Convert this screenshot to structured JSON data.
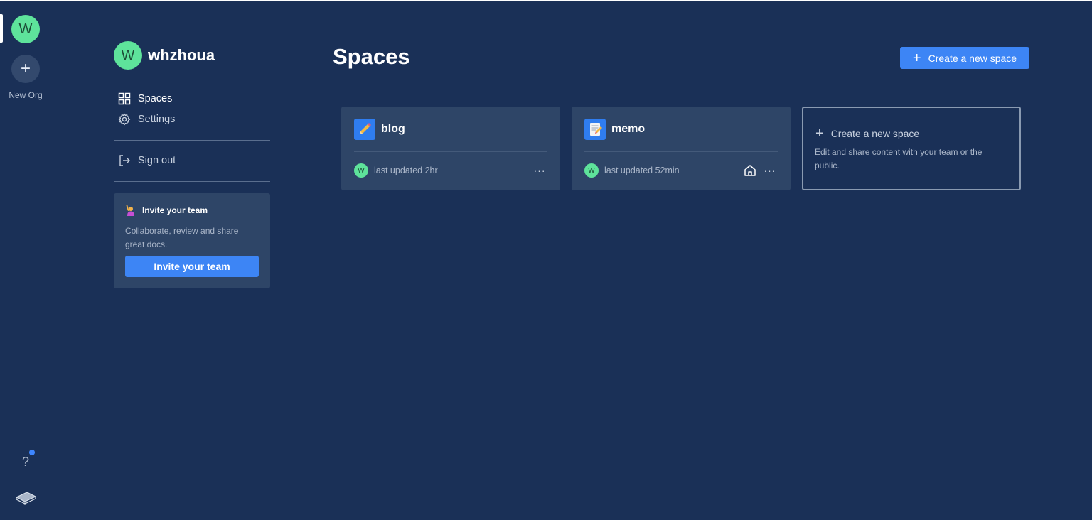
{
  "org_rail": {
    "org_avatar_letter": "W",
    "new_org_symbol": "+",
    "new_org_label": "New Org",
    "help_symbol": "?",
    "help_icon": "question-mark-icon",
    "logo_icon": "app-logo-icon"
  },
  "sidebar": {
    "user_avatar_letter": "W",
    "user_name": "whzhoua",
    "items": [
      {
        "label": "Spaces",
        "icon": "grid-icon"
      },
      {
        "label": "Settings",
        "icon": "gear-icon"
      },
      {
        "label": "Sign out",
        "icon": "sign-out-icon"
      }
    ],
    "invite": {
      "title": "Invite your team",
      "description": "Collaborate, review and share great docs.",
      "button_label": "Invite your team"
    }
  },
  "main": {
    "title": "Spaces",
    "create_button": {
      "symbol": "+",
      "label": "Create a new space"
    },
    "spaces": [
      {
        "name": "blog",
        "icon": "pencil-icon",
        "avatar_letter": "W",
        "updated": "last updated 2hr",
        "more": "···",
        "is_home": false
      },
      {
        "name": "memo",
        "icon": "memo-icon",
        "avatar_letter": "W",
        "updated": "last updated 52min",
        "more": "···",
        "is_home": true
      }
    ],
    "new_space_card": {
      "symbol": "+",
      "title": "Create a new space",
      "description": "Edit and share content with your team or the public."
    }
  },
  "colors": {
    "background": "#1a3057",
    "card": "#2e4567",
    "accent": "#3d85f5",
    "avatar": "#5ee39b"
  }
}
